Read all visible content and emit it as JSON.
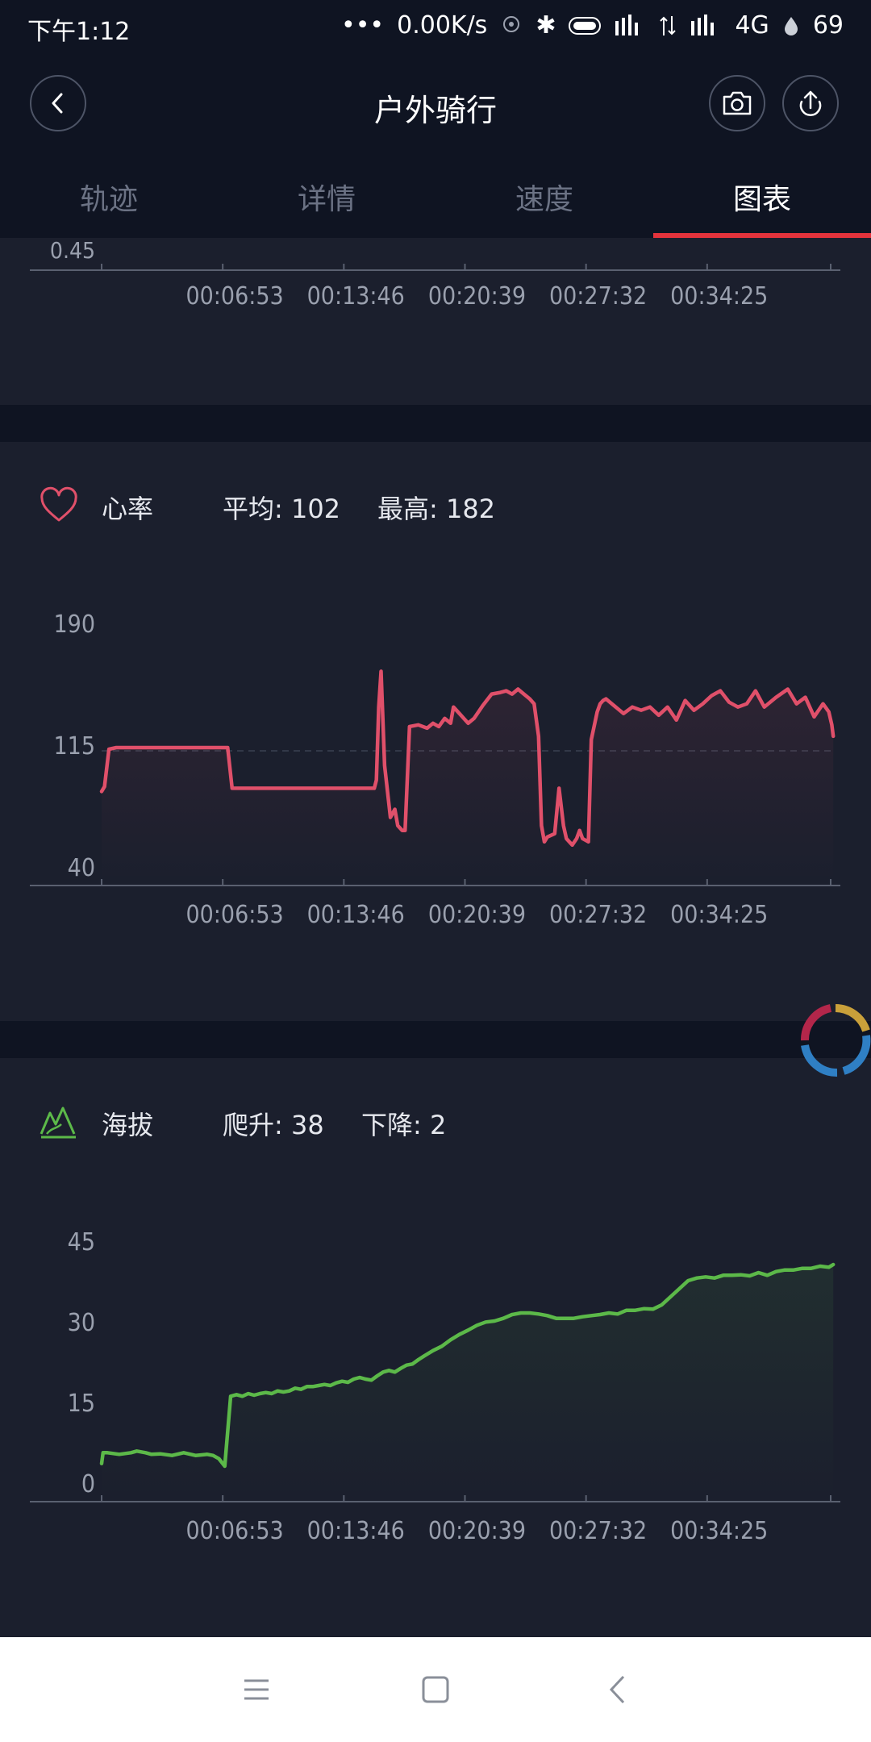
{
  "status": {
    "time": "下午1:12",
    "network_speed": "0.00K/s",
    "network_type": "4G",
    "battery": "69"
  },
  "header": {
    "title": "户外骑行",
    "tabs": [
      "轨迹",
      "详情",
      "速度",
      "图表"
    ],
    "active_tab": 3
  },
  "speed_card": {
    "visible_ytick": "0.45"
  },
  "heart_rate": {
    "label": "心率",
    "avg_text": "平均: 102",
    "max_text": "最高: 182",
    "color": "#e0506a"
  },
  "altitude": {
    "label": "海拔",
    "climb_text": "爬升: 38",
    "descent_text": "下降: 2",
    "color": "#5cb949"
  },
  "chart_data": [
    {
      "type": "line",
      "xticks": [
        "00:06:53",
        "00:13:46",
        "00:20:39",
        "00:27:32",
        "00:34:25"
      ],
      "yticks": [
        "0.45"
      ]
    },
    {
      "type": "area",
      "title": "心率",
      "yticks": [
        40,
        115,
        190
      ],
      "ylim": [
        40,
        190
      ],
      "xlim": [
        0,
        2500
      ],
      "xticks": [
        "00:06:53",
        "00:13:46",
        "00:20:39",
        "00:27:32",
        "00:34:25"
      ],
      "xtick_seconds": [
        413,
        826,
        1239,
        1652,
        2065
      ],
      "reference_line": 111,
      "series": [
        {
          "x": [
            0,
            10,
            25,
            50,
            400,
            430,
            445,
            700,
            930,
            937,
            945,
            953,
            965,
            985,
            1000,
            1010,
            1025,
            1035,
            1050,
            1080,
            1110,
            1130,
            1150,
            1170,
            1190,
            1200,
            1220,
            1250,
            1270,
            1300,
            1330,
            1360,
            1380,
            1400,
            1420,
            1440,
            1460,
            1475,
            1490,
            1500,
            1510,
            1520,
            1545,
            1560,
            1575,
            1585,
            1605,
            1620,
            1630,
            1640,
            1660,
            1670,
            1690,
            1700,
            1710,
            1720,
            1760,
            1780,
            1810,
            1840,
            1870,
            1900,
            1930,
            1960,
            1990,
            2020,
            2050,
            2080,
            2110,
            2140,
            2170,
            2200,
            2230,
            2260,
            2300,
            2340,
            2370,
            2400,
            2430,
            2460,
            2480,
            2490,
            2495
          ],
          "y": [
            86,
            89,
            112,
            113,
            113,
            113,
            88,
            88,
            88,
            93,
            138,
            160,
            102,
            70,
            75,
            65,
            62,
            62,
            126,
            127,
            125,
            128,
            126,
            131,
            128,
            138,
            134,
            128,
            131,
            139,
            146,
            147,
            148,
            146,
            149,
            146,
            143,
            140,
            120,
            65,
            55,
            58,
            60,
            88,
            65,
            57,
            53,
            57,
            62,
            57,
            55,
            118,
            135,
            140,
            142,
            143,
            137,
            134,
            138,
            136,
            138,
            133,
            138,
            130,
            142,
            136,
            140,
            145,
            148,
            141,
            138,
            140,
            148,
            138,
            144,
            149,
            140,
            144,
            132,
            140,
            135,
            127,
            120
          ]
        }
      ]
    },
    {
      "type": "area",
      "title": "海拔",
      "yticks": [
        0,
        15,
        30,
        45
      ],
      "ylim": [
        0,
        45
      ],
      "xlim": [
        0,
        2500
      ],
      "xticks": [
        "00:06:53",
        "00:13:46",
        "00:20:39",
        "00:27:32",
        "00:34:25"
      ],
      "xtick_seconds": [
        413,
        826,
        1239,
        1652,
        2065
      ],
      "series": [
        {
          "x": [
            0,
            5,
            20,
            60,
            100,
            120,
            150,
            170,
            200,
            240,
            280,
            320,
            360,
            380,
            400,
            420,
            440,
            460,
            480,
            500,
            520,
            540,
            560,
            580,
            600,
            620,
            640,
            660,
            680,
            700,
            720,
            740,
            760,
            780,
            800,
            820,
            840,
            860,
            880,
            900,
            920,
            940,
            960,
            980,
            1000,
            1020,
            1040,
            1060,
            1080,
            1100,
            1130,
            1160,
            1190,
            1220,
            1250,
            1280,
            1310,
            1340,
            1370,
            1400,
            1430,
            1460,
            1490,
            1520,
            1550,
            1580,
            1610,
            1640,
            1670,
            1700,
            1730,
            1760,
            1790,
            1820,
            1850,
            1880,
            1910,
            1940,
            1970,
            2000,
            2030,
            2060,
            2090,
            2120,
            2150,
            2180,
            2210,
            2240,
            2270,
            2300,
            2330,
            2360,
            2390,
            2420,
            2450,
            2480,
            2495
          ],
          "y": [
            3.5,
            5.5,
            5.5,
            5.2,
            5.5,
            5.8,
            5.5,
            5.2,
            5.3,
            5.0,
            5.5,
            5.0,
            5.2,
            5.0,
            4.4,
            3.0,
            16.0,
            16.3,
            16.0,
            16.5,
            16.2,
            16.5,
            16.7,
            16.5,
            17.0,
            16.8,
            17.0,
            17.5,
            17.3,
            17.8,
            17.8,
            18.0,
            18.2,
            18.0,
            18.5,
            18.8,
            18.6,
            19.2,
            19.5,
            19.2,
            19.0,
            19.8,
            20.5,
            20.8,
            20.5,
            21.2,
            21.8,
            22.0,
            22.8,
            23.5,
            24.5,
            25.3,
            26.5,
            27.5,
            28.3,
            29.2,
            29.8,
            30.0,
            30.5,
            31.2,
            31.5,
            31.5,
            31.3,
            31.0,
            30.5,
            30.5,
            30.5,
            30.8,
            31.0,
            31.2,
            31.5,
            31.3,
            32.0,
            32.0,
            32.3,
            32.2,
            33.0,
            34.5,
            36.0,
            37.5,
            38.0,
            38.2,
            38.0,
            38.5,
            38.5,
            38.6,
            38.4,
            39.0,
            38.5,
            39.2,
            39.5,
            39.5,
            39.8,
            39.8,
            40.2,
            40.0,
            40.5
          ]
        }
      ]
    }
  ],
  "icons": {
    "back": "chevron-left-icon",
    "camera": "camera-icon",
    "share": "upload-icon",
    "heart": "heart-icon",
    "mountain": "mountain-icon"
  },
  "colors": {
    "background": "#1b1f2d",
    "header": "#0f1422",
    "tab_indicator": "#e3333c"
  }
}
